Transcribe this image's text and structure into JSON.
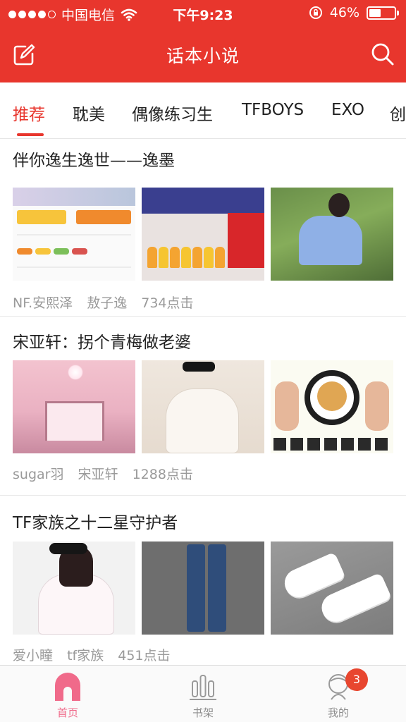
{
  "status_bar": {
    "carrier": "中国电信",
    "time": "下午9:23",
    "battery_percent": "46%",
    "battery_level": 0.46,
    "signal_bars": 4
  },
  "header": {
    "title": "话本小说",
    "edit_icon": "edit-icon",
    "search_icon": "search-icon"
  },
  "tabs": [
    {
      "label": "推荐",
      "active": true
    },
    {
      "label": "耽美"
    },
    {
      "label": "偶像练习生"
    },
    {
      "label": "TFBOYS"
    },
    {
      "label": "EXO"
    },
    {
      "label": "创"
    }
  ],
  "posts": [
    {
      "title": "伴你逸生逸世——逸墨",
      "author": "NF.安熙泽",
      "tag": "敖子逸",
      "clicks": "734点击"
    },
    {
      "title": "宋亚轩：拐个青梅做老婆",
      "author": "sugar羽",
      "tag": "宋亚轩",
      "clicks": "1288点击"
    },
    {
      "title": "TF家族之十二星守护者",
      "author": "爱小瞳",
      "tag": "tf家族",
      "clicks": "451点击"
    }
  ],
  "bottom_nav": [
    {
      "label": "首页",
      "icon": "home-icon",
      "active": true
    },
    {
      "label": "书架",
      "icon": "bookshelf-icon"
    },
    {
      "label": "我的",
      "icon": "profile-icon",
      "badge": "3"
    }
  ],
  "colors": {
    "brand_red": "#e8362d",
    "active_tab_red": "#e8362d",
    "home_pink": "#f06a8a",
    "badge_red": "#e8462f",
    "meta_gray": "#9a9a9a"
  }
}
